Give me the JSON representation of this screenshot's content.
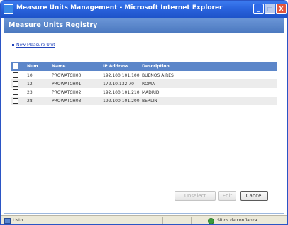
{
  "window": {
    "title": "Measure Units Management - Microsoft Internet Explorer",
    "controls": {
      "minimize": "_",
      "maximize": "□",
      "close": "X"
    }
  },
  "page": {
    "heading": "Measure Units Registry",
    "new_link": "New Measure Unit"
  },
  "table": {
    "headers": {
      "num": "Num",
      "name": "Name",
      "ip": "IP Address",
      "desc": "Description"
    },
    "rows": [
      {
        "num": "10",
        "name": "PROWATCH00",
        "ip": "192.100.101.100",
        "desc": "BUENOS AIRES"
      },
      {
        "num": "12",
        "name": "PROWATCH01",
        "ip": "172.10.132.70",
        "desc": "ROMA"
      },
      {
        "num": "23",
        "name": "PROWATCH02",
        "ip": "192.100.101.210",
        "desc": "MADRID"
      },
      {
        "num": "28",
        "name": "PROWATCH03",
        "ip": "192.100.101.200",
        "desc": "BERLIN"
      }
    ]
  },
  "buttons": {
    "unselect": "Unselect",
    "edit": "Edit",
    "cancel": "Cancel"
  },
  "status": {
    "left": "Listo",
    "zone": "Sitios de confianza"
  }
}
